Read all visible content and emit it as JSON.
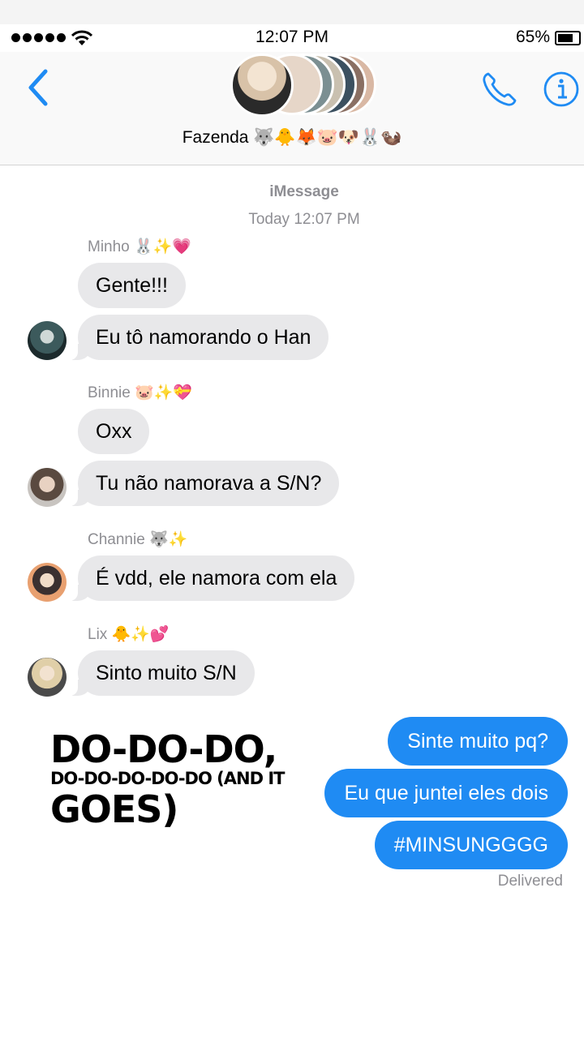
{
  "status_bar": {
    "time": "12:07 PM",
    "battery_percent": "65%",
    "battery_level": 0.65
  },
  "header": {
    "group_name": "Fazenda 🐺🐥🦊🐷🐶🐰🦦",
    "back_icon": "chevron-left-icon",
    "call_icon": "phone-icon",
    "info_icon": "info-icon",
    "accent_color": "#1f8bf3"
  },
  "thread": {
    "service": "iMessage",
    "timestamp": "Today 12:07 PM",
    "groups": [
      {
        "sender": "Minho 🐰✨💗",
        "messages": [
          "Gente!!!",
          "Eu tô namorando o Han"
        ]
      },
      {
        "sender": "Binnie 🐷✨💝",
        "messages": [
          "Oxx",
          "Tu não namorava a S/N?"
        ]
      },
      {
        "sender": "Channie 🐺✨",
        "messages": [
          "É vdd, ele namora com ela"
        ]
      },
      {
        "sender": "Lix 🐥✨💕",
        "messages": [
          "Sinto muito S/N"
        ]
      }
    ],
    "outgoing": [
      "Sinte muito pq?",
      "Eu que juntei eles dois",
      "#MINSUNGGGG"
    ],
    "delivered": "Delivered"
  },
  "overlay_lyrics": {
    "line1": "DO-DO-DO,",
    "line2": "DO-DO-DO-DO-DO (AND IT",
    "line3": "GOES)"
  },
  "colors": {
    "incoming_bubble": "#e8e8ea",
    "outgoing_bubble": "#1f8bf3",
    "meta_text": "#8e8e93"
  }
}
